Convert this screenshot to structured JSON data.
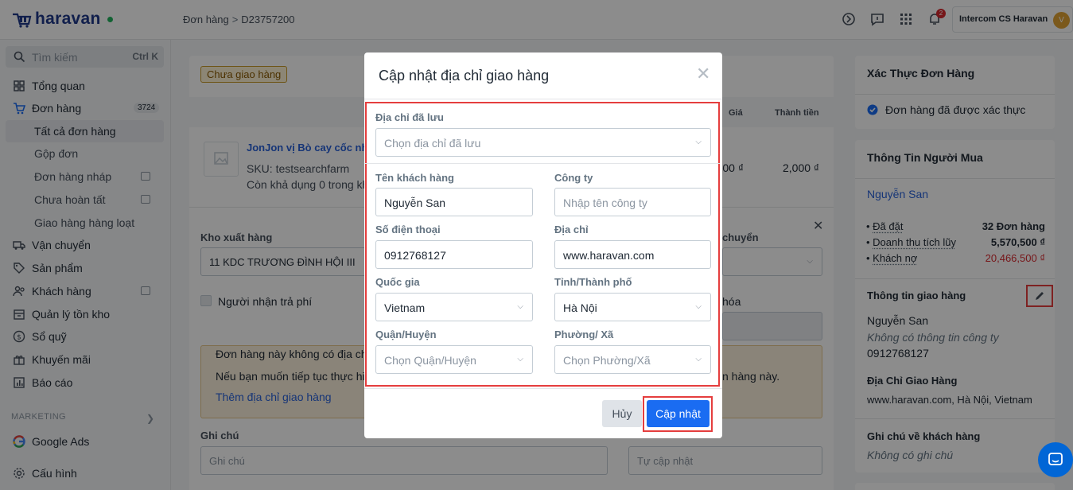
{
  "header": {
    "logo": "haravan",
    "breadcrumb": [
      "Đơn hàng",
      "D23757200"
    ],
    "notification_count": "2",
    "user_name": "Intercom CS Haravan",
    "user_initial": "V"
  },
  "sidebar": {
    "search_placeholder": "Tìm kiếm",
    "search_shortcut": "Ctrl K",
    "items": [
      {
        "label": "Tổng quan",
        "icon": "dashboard-icon"
      },
      {
        "label": "Đơn hàng",
        "icon": "cart-icon",
        "badge": "3724"
      },
      {
        "label": "Tất cả đơn hàng"
      },
      {
        "label": "Gộp đơn"
      },
      {
        "label": "Đơn hàng nháp"
      },
      {
        "label": "Chưa hoàn tất"
      },
      {
        "label": "Giao hàng hàng loạt"
      },
      {
        "label": "Vận chuyển",
        "icon": "truck-icon"
      },
      {
        "label": "Sản phẩm",
        "icon": "tag-icon"
      },
      {
        "label": "Khách hàng",
        "icon": "users-icon"
      },
      {
        "label": "Quản lý tồn kho",
        "icon": "inventory-icon"
      },
      {
        "label": "Sổ quỹ",
        "icon": "dollar-icon"
      },
      {
        "label": "Khuyến mãi",
        "icon": "gift-icon"
      },
      {
        "label": "Báo cáo",
        "icon": "chart-icon"
      }
    ],
    "section_marketing": "MARKETING",
    "google_ads": "Google Ads",
    "settings": "Cấu hình"
  },
  "order": {
    "status_tag": "Chưa giao hàng",
    "col_price": "Giá",
    "col_total": "Thành tiền",
    "product_name": "JonJon vị Bò cay cốc nh",
    "sku": "SKU: testsearchfarm",
    "stock": "Còn khả dụng 0 trong kh",
    "price": "2,000 ₫",
    "total": "2,000 ₫",
    "warehouse_label": "Kho xuất hàng",
    "warehouse_value": "11 KDC TRƯƠNG ĐÌNH HỘI III",
    "shipping_label": "chuyển",
    "receiver_pays": "Người nhận trả phí",
    "goods_label": "hóa",
    "warning_line1": "Đơn hàng này không có địa chỉ",
    "warning_line2": "Nếu bạn muốn tiếp tục thực hiệ",
    "warning_line2_tail": "n hàng này.",
    "add_address_link": "Thêm địa chỉ giao hàng",
    "note_label": "Ghi chú",
    "note_placeholder": "Ghi chú",
    "auto_update_placeholder": "Tự cập nhật"
  },
  "right_panel": {
    "verify_title": "Xác Thực Đơn Hàng",
    "verify_status": "Đơn hàng đã được xác thực",
    "buyer_title": "Thông Tin Người Mua",
    "buyer_name": "Nguyễn San",
    "stats": [
      {
        "label": "Đã đặt",
        "value": "32 Đơn hàng"
      },
      {
        "label": "Doanh thu tích lũy",
        "value": "5,570,500 ₫"
      },
      {
        "label": "Khách nợ",
        "value": "20,466,500 ₫"
      }
    ],
    "shipping_title": "Thông tin giao hàng",
    "shipping_name": "Nguyễn San",
    "shipping_company": "Không có thông tin công ty",
    "shipping_phone": "0912768127",
    "address_title": "Địa Chỉ Giao Hàng",
    "address_value": "www.haravan.com, Hà Nội, Vietnam",
    "note_title": "Ghi chú về khách hàng",
    "note_value": "Không có ghi chú"
  },
  "modal": {
    "title": "Cập nhật địa chỉ giao hàng",
    "saved_address_label": "Địa chỉ đã lưu",
    "saved_address_placeholder": "Chọn địa chỉ đã lưu",
    "customer_name_label": "Tên khách hàng",
    "customer_name_value": "Nguyễn San",
    "company_label": "Công ty",
    "company_placeholder": "Nhập tên công ty",
    "phone_label": "Số điện thoại",
    "phone_value": "0912768127",
    "address_label": "Địa chỉ",
    "address_value": "www.haravan.com",
    "country_label": "Quốc gia",
    "country_value": "Vietnam",
    "province_label": "Tỉnh/Thành phố",
    "province_value": "Hà Nội",
    "district_label": "Quận/Huyện",
    "district_placeholder": "Chọn Quận/Huyện",
    "ward_label": "Phường/ Xã",
    "ward_placeholder": "Chọn Phường/Xã",
    "cancel_label": "Hủy",
    "update_label": "Cập nhật"
  },
  "colors": {
    "primary": "#1a6cf2",
    "highlight": "#e53e3e",
    "brand": "#1f3a8a"
  }
}
